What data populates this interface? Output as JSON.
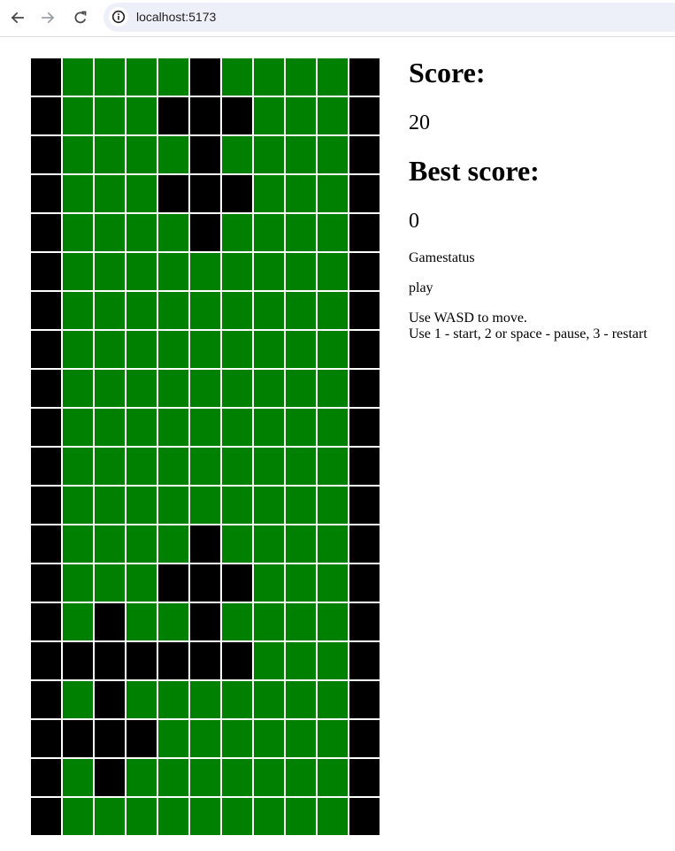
{
  "browser": {
    "url": "localhost:5173",
    "icons": {
      "back": "arrow-left-icon",
      "forward": "arrow-right-icon",
      "reload": "reload-icon",
      "site_info": "info-circle-icon"
    }
  },
  "colors": {
    "filled_cell": "#000000",
    "empty_cell": "#008000",
    "grid_line": "#ffffff"
  },
  "board": {
    "columns": 11,
    "rows": 20,
    "cells": [
      [
        1,
        0,
        0,
        0,
        0,
        1,
        0,
        0,
        0,
        0,
        1
      ],
      [
        1,
        0,
        0,
        0,
        1,
        1,
        1,
        0,
        0,
        0,
        1
      ],
      [
        1,
        0,
        0,
        0,
        0,
        1,
        0,
        0,
        0,
        0,
        1
      ],
      [
        1,
        0,
        0,
        0,
        1,
        1,
        1,
        0,
        0,
        0,
        1
      ],
      [
        1,
        0,
        0,
        0,
        0,
        1,
        0,
        0,
        0,
        0,
        1
      ],
      [
        1,
        0,
        0,
        0,
        0,
        0,
        0,
        0,
        0,
        0,
        1
      ],
      [
        1,
        0,
        0,
        0,
        0,
        0,
        0,
        0,
        0,
        0,
        1
      ],
      [
        1,
        0,
        0,
        0,
        0,
        0,
        0,
        0,
        0,
        0,
        1
      ],
      [
        1,
        0,
        0,
        0,
        0,
        0,
        0,
        0,
        0,
        0,
        1
      ],
      [
        1,
        0,
        0,
        0,
        0,
        0,
        0,
        0,
        0,
        0,
        1
      ],
      [
        1,
        0,
        0,
        0,
        0,
        0,
        0,
        0,
        0,
        0,
        1
      ],
      [
        1,
        0,
        0,
        0,
        0,
        0,
        0,
        0,
        0,
        0,
        1
      ],
      [
        1,
        0,
        0,
        0,
        0,
        1,
        0,
        0,
        0,
        0,
        1
      ],
      [
        1,
        0,
        0,
        0,
        1,
        1,
        1,
        0,
        0,
        0,
        1
      ],
      [
        1,
        0,
        1,
        0,
        0,
        1,
        0,
        0,
        0,
        0,
        1
      ],
      [
        1,
        1,
        1,
        1,
        1,
        1,
        1,
        0,
        0,
        0,
        1
      ],
      [
        1,
        0,
        1,
        0,
        0,
        0,
        0,
        0,
        0,
        0,
        1
      ],
      [
        1,
        1,
        1,
        1,
        0,
        0,
        0,
        0,
        0,
        0,
        1
      ],
      [
        1,
        0,
        1,
        0,
        0,
        0,
        0,
        0,
        0,
        0,
        1
      ],
      [
        1,
        0,
        0,
        0,
        0,
        0,
        0,
        0,
        0,
        0,
        1
      ]
    ]
  },
  "panel": {
    "score_title": "Score:",
    "score_value": "20",
    "best_title": "Best score:",
    "best_value": "0",
    "status_label": "Gamestatus",
    "status_value": "play",
    "help_line1": "Use WASD to move.",
    "help_line2": "Use 1 - start, 2 or space - pause, 3 - restart"
  }
}
